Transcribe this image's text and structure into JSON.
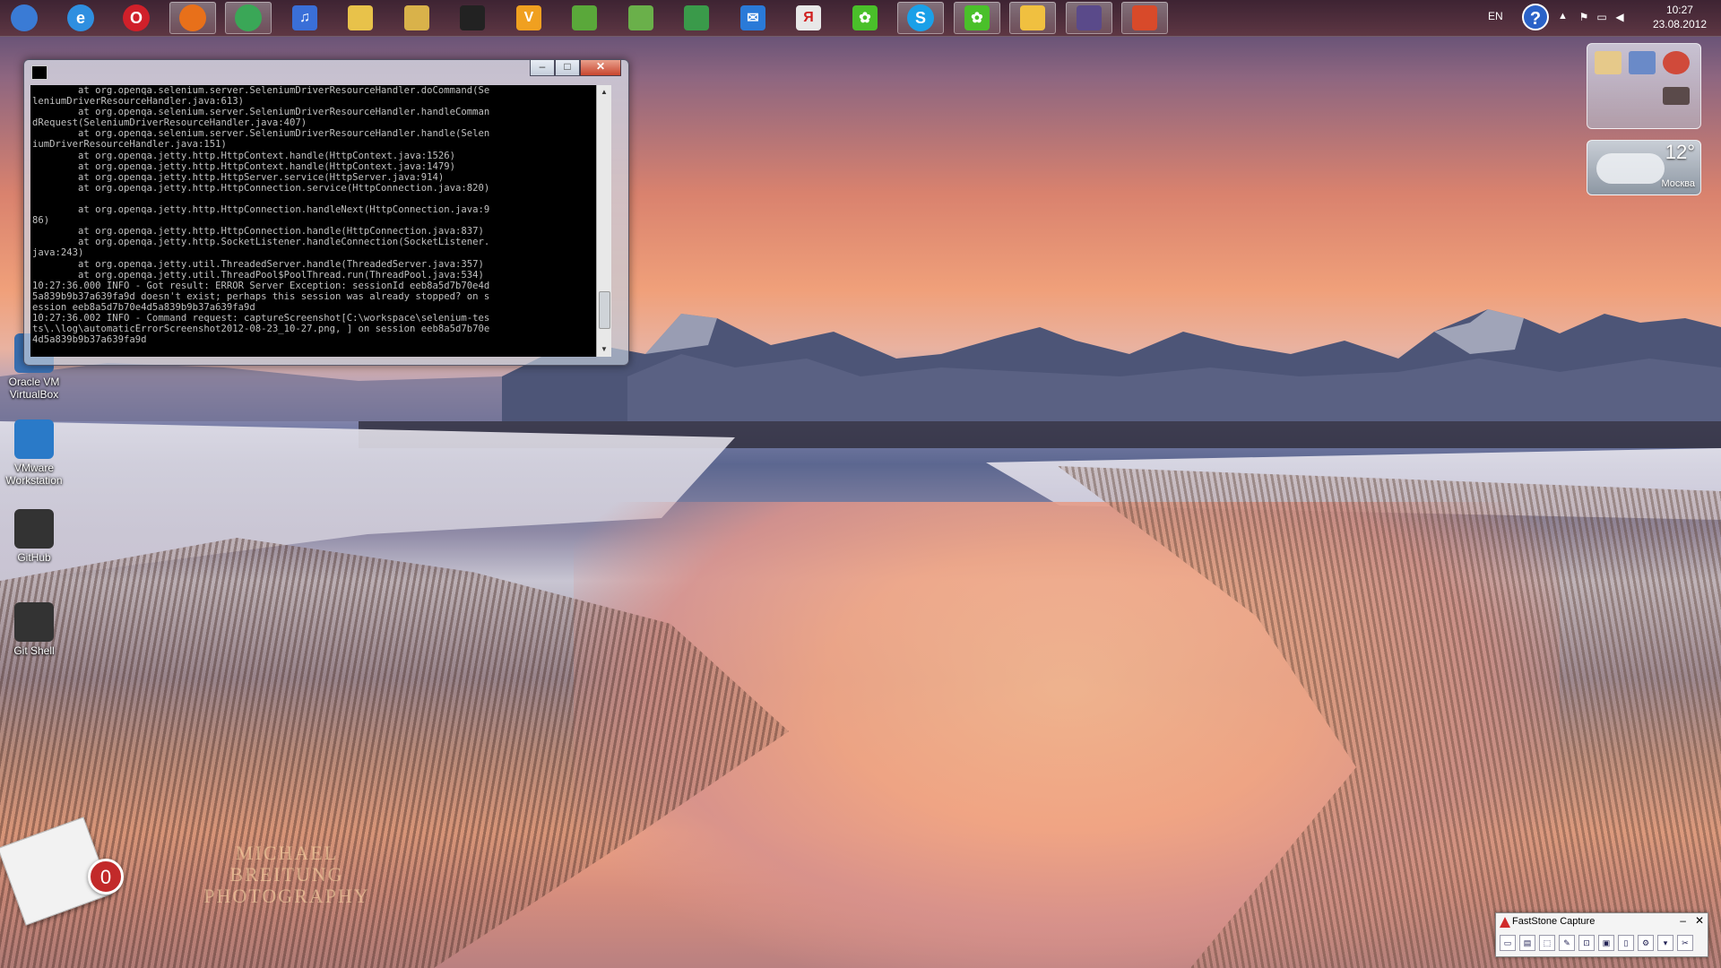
{
  "taskbar": {
    "apps": [
      {
        "name": "start-orb",
        "glyph": "",
        "color": "#3a7bd5",
        "active": false
      },
      {
        "name": "internet-explorer",
        "glyph": "e",
        "color": "#2f8fe0",
        "active": false
      },
      {
        "name": "opera",
        "glyph": "O",
        "color": "#d0202a",
        "active": false
      },
      {
        "name": "firefox",
        "glyph": "",
        "color": "#e8701a",
        "active": true
      },
      {
        "name": "chrome",
        "glyph": "",
        "color": "#3aa757",
        "active": true
      },
      {
        "name": "itunes",
        "glyph": "♫",
        "color": "#3a6fd8",
        "active": false
      },
      {
        "name": "file-manager",
        "glyph": "",
        "color": "#e8c24a",
        "active": false
      },
      {
        "name": "explorer",
        "glyph": "",
        "color": "#d9b24a",
        "active": false
      },
      {
        "name": "epub-reader",
        "glyph": "",
        "color": "#222222",
        "active": false
      },
      {
        "name": "app-v",
        "glyph": "V",
        "color": "#f0a020",
        "active": false
      },
      {
        "name": "evernote",
        "glyph": "",
        "color": "#5aa83a",
        "active": false
      },
      {
        "name": "network-tool",
        "glyph": "",
        "color": "#6ab04a",
        "active": false
      },
      {
        "name": "spreadsheet",
        "glyph": "",
        "color": "#3a9a4a",
        "active": false
      },
      {
        "name": "mail",
        "glyph": "✉",
        "color": "#2a7ad8",
        "active": false
      },
      {
        "name": "yandex",
        "glyph": "Я",
        "color": "#e8e8e8",
        "active": false
      },
      {
        "name": "icq",
        "glyph": "✿",
        "color": "#4ac02a",
        "active": false
      },
      {
        "name": "skype",
        "glyph": "S",
        "color": "#1aa0e8",
        "active": true
      },
      {
        "name": "icq-2",
        "glyph": "✿",
        "color": "#4ac02a",
        "active": true
      },
      {
        "name": "messenger",
        "glyph": "",
        "color": "#f0c040",
        "active": true
      },
      {
        "name": "ide",
        "glyph": "",
        "color": "#5a4a8a",
        "active": true
      },
      {
        "name": "java",
        "glyph": "",
        "color": "#d84a2a",
        "active": true
      }
    ],
    "tray": {
      "language": "EN",
      "help": "?",
      "arrow": "▲",
      "time": "10:27",
      "date": "23.08.2012"
    }
  },
  "desktop_icons": [
    {
      "name": "oracle-vm-virtualbox",
      "label": "Oracle VM\nVirtualBox",
      "color": "#3a6fb0"
    },
    {
      "name": "vmware-workstation",
      "label": "VMware\nWorkstation",
      "color": "#2a7ac8"
    },
    {
      "name": "github",
      "label": "GitHub",
      "color": "#333333"
    },
    {
      "name": "git-shell",
      "label": "Git Shell",
      "color": "#333333"
    }
  ],
  "console": {
    "lines": [
      "        at org.openqa.selenium.server.SeleniumDriverResourceHandler.doCommand(Se",
      "leniumDriverResourceHandler.java:613)",
      "        at org.openqa.selenium.server.SeleniumDriverResourceHandler.handleComman",
      "dRequest(SeleniumDriverResourceHandler.java:407)",
      "        at org.openqa.selenium.server.SeleniumDriverResourceHandler.handle(Selen",
      "iumDriverResourceHandler.java:151)",
      "        at org.openqa.jetty.http.HttpContext.handle(HttpContext.java:1526)",
      "        at org.openqa.jetty.http.HttpContext.handle(HttpContext.java:1479)",
      "        at org.openqa.jetty.http.HttpServer.service(HttpServer.java:914)",
      "        at org.openqa.jetty.http.HttpConnection.service(HttpConnection.java:820)",
      "",
      "        at org.openqa.jetty.http.HttpConnection.handleNext(HttpConnection.java:9",
      "86)",
      "        at org.openqa.jetty.http.HttpConnection.handle(HttpConnection.java:837)",
      "        at org.openqa.jetty.http.SocketListener.handleConnection(SocketListener.",
      "java:243)",
      "        at org.openqa.jetty.util.ThreadedServer.handle(ThreadedServer.java:357)",
      "        at org.openqa.jetty.util.ThreadPool$PoolThread.run(ThreadPool.java:534)",
      "10:27:36.000 INFO - Got result: ERROR Server Exception: sessionId eeb8a5d7b70e4d",
      "5a839b9b37a639fa9d doesn't exist; perhaps this session was already stopped? on s",
      "ession eeb8a5d7b70e4d5a839b9b37a639fa9d",
      "10:27:36.002 INFO - Command request: captureScreenshot[C:\\workspace\\selenium-tes",
      "ts\\.\\log\\automaticErrorScreenshot2012-08-23_10-27.png, ] on session eeb8a5d7b70e",
      "4d5a839b9b37a639fa9d"
    ],
    "buttons": {
      "minimize": "–",
      "maximize": "□",
      "close": "✕"
    },
    "scroll": {
      "up": "▲",
      "down": "▼"
    }
  },
  "gadgets": {
    "weather": {
      "temperature": "12°",
      "city": "Москва"
    }
  },
  "watermark": {
    "line1": "MICHAEL BREITUNG",
    "line2": "PHOTOGRAPHY"
  },
  "mail_widget": {
    "count": "0"
  },
  "faststone": {
    "title": "FastStone Capture",
    "minimize": "–",
    "close": "✕",
    "tools": [
      "▭",
      "▤",
      "⬚",
      "✎",
      "⊡",
      "▣",
      "▯",
      "⚙",
      "▾",
      "✂"
    ]
  }
}
